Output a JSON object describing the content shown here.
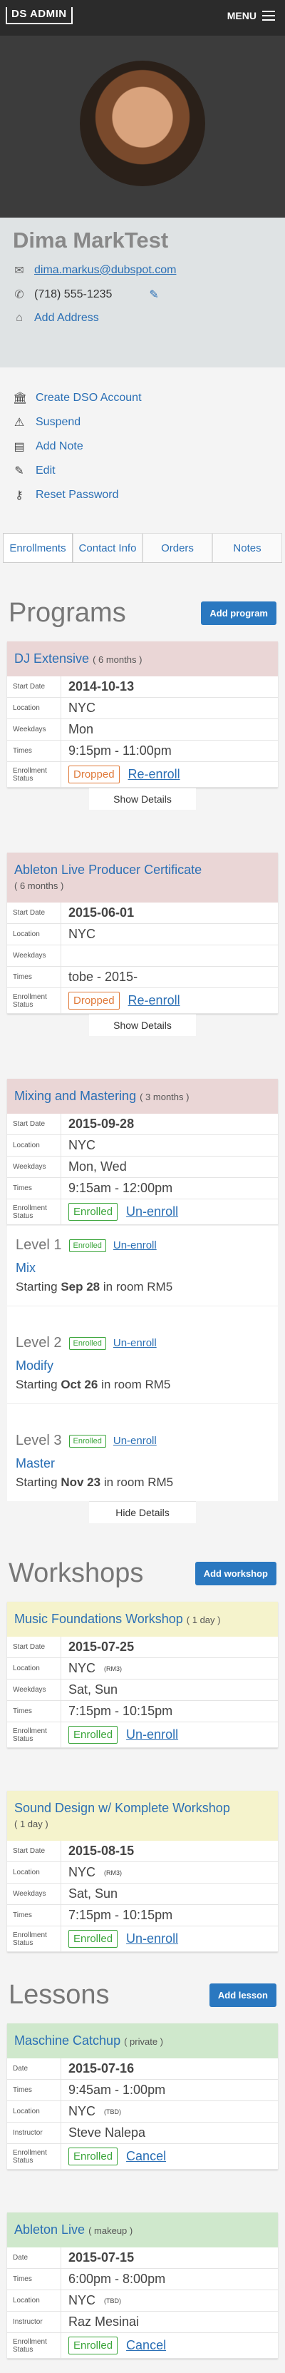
{
  "app": {
    "logo": "DS ADMIN",
    "menu_label": "MENU"
  },
  "profile": {
    "name": "Dima MarkTest",
    "email": "dima.markus@dubspot.com",
    "phone": "(718) 555-1235",
    "add_address": "Add Address"
  },
  "actions": [
    "Create DSO Account",
    "Suspend",
    "Add Note",
    "Edit",
    "Reset Password"
  ],
  "tabs": [
    "Enrollments",
    "Contact Info",
    "Orders",
    "Notes"
  ],
  "labels": {
    "start_date": "Start Date",
    "location": "Location",
    "weekdays": "Weekdays",
    "times": "Times",
    "enrollment_status": "Enrollment Status",
    "date": "Date",
    "instructor": "Instructor"
  },
  "programs": {
    "title": "Programs",
    "add_label": "Add program",
    "items": [
      {
        "name": "DJ Extensive",
        "duration": "( 6 months )",
        "start": "2014-10-13",
        "location": "NYC",
        "weekdays": "Mon",
        "times": "9:15pm - 11:00pm",
        "status": "Dropped",
        "action": "Re-enroll",
        "toggle": "Show Details"
      },
      {
        "name": "Ableton Live Producer Certificate",
        "duration": "( 6 months )",
        "start": "2015-06-01",
        "location": "NYC",
        "weekdays": "",
        "times": "tobe - 2015-",
        "status": "Dropped",
        "action": "Re-enroll",
        "toggle": "Show Details"
      },
      {
        "name": "Mixing and Mastering",
        "duration": "( 3 months )",
        "start": "2015-09-28",
        "location": "NYC",
        "weekdays": "Mon, Wed",
        "times": "9:15am - 12:00pm",
        "status": "Enrolled",
        "action": "Un-enroll",
        "toggle": "Hide Details",
        "levels": [
          {
            "label": "Level 1",
            "status": "Enrolled",
            "action": "Un-enroll",
            "title": "Mix",
            "starting_prefix": "Starting",
            "starting_date": "Sep 28",
            "room": "in room RM5"
          },
          {
            "label": "Level 2",
            "status": "Enrolled",
            "action": "Un-enroll",
            "title": "Modify",
            "starting_prefix": "Starting",
            "starting_date": "Oct 26",
            "room": "in room RM5"
          },
          {
            "label": "Level 3",
            "status": "Enrolled",
            "action": "Un-enroll",
            "title": "Master",
            "starting_prefix": "Starting",
            "starting_date": "Nov 23",
            "room": "in room RM5"
          }
        ]
      }
    ]
  },
  "workshops": {
    "title": "Workshops",
    "add_label": "Add workshop",
    "items": [
      {
        "name": "Music Foundations Workshop",
        "duration": "( 1 day )",
        "start": "2015-07-25",
        "location": "NYC",
        "room": "(RM3)",
        "weekdays": "Sat, Sun",
        "times": "7:15pm - 10:15pm",
        "status": "Enrolled",
        "action": "Un-enroll"
      },
      {
        "name": "Sound Design w/ Komplete Workshop",
        "duration": "( 1 day )",
        "start": "2015-08-15",
        "location": "NYC",
        "room": "(RM3)",
        "weekdays": "Sat, Sun",
        "times": "7:15pm - 10:15pm",
        "status": "Enrolled",
        "action": "Un-enroll"
      }
    ]
  },
  "lessons": {
    "title": "Lessons",
    "add_label": "Add lesson",
    "items": [
      {
        "name": "Maschine Catchup",
        "kind": "( private )",
        "date": "2015-07-16",
        "times": "9:45am - 1:00pm",
        "location": "NYC",
        "room": "(TBD)",
        "instructor": "Steve Nalepa",
        "status": "Enrolled",
        "action": "Cancel"
      },
      {
        "name": "Ableton Live",
        "kind": "( makeup )",
        "date": "2015-07-15",
        "times": "6:00pm - 8:00pm",
        "location": "NYC",
        "room": "(TBD)",
        "instructor": "Raz Mesinai",
        "status": "Enrolled",
        "action": "Cancel"
      }
    ]
  }
}
